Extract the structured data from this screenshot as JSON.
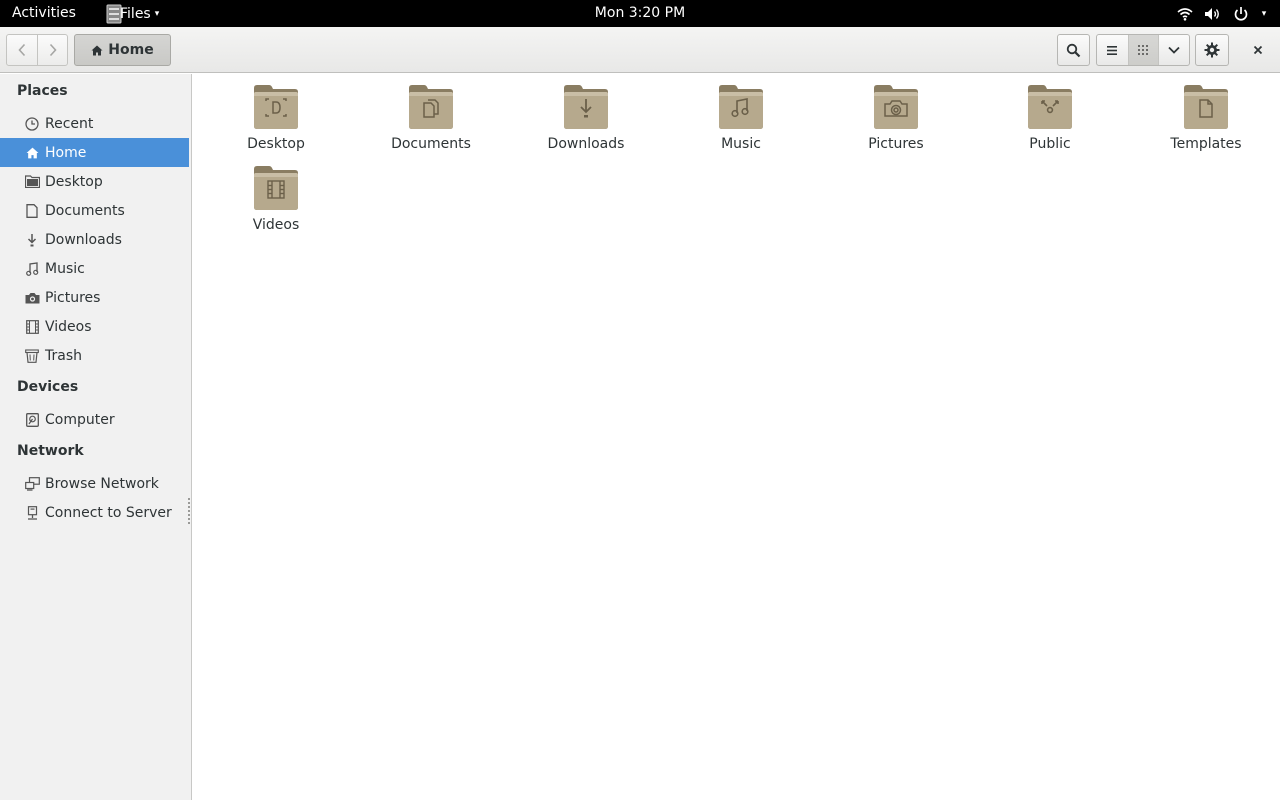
{
  "topbar": {
    "activities": "Activities",
    "app_name": "Files",
    "app_caret": "▾",
    "clock": "Mon  3:20 PM",
    "status_icons": [
      "wifi-icon",
      "volume-icon",
      "power-icon"
    ]
  },
  "headerbar": {
    "path_label": "Home",
    "icons": [
      "back-icon",
      "forward-icon",
      "home-icon",
      "search-icon",
      "list-view-icon",
      "grid-view-icon",
      "chevron-down-icon",
      "gear-icon",
      "close-icon"
    ],
    "active_view": "grid"
  },
  "sidebar": {
    "places_title": "Places",
    "places": [
      {
        "label": "Recent",
        "icon": "clock-icon"
      },
      {
        "label": "Home",
        "icon": "home-icon",
        "selected": true
      },
      {
        "label": "Desktop",
        "icon": "folder-icon"
      },
      {
        "label": "Documents",
        "icon": "document-icon"
      },
      {
        "label": "Downloads",
        "icon": "download-icon"
      },
      {
        "label": "Music",
        "icon": "music-icon"
      },
      {
        "label": "Pictures",
        "icon": "camera-icon"
      },
      {
        "label": "Videos",
        "icon": "film-icon"
      },
      {
        "label": "Trash",
        "icon": "trash-icon"
      }
    ],
    "devices_title": "Devices",
    "devices": [
      {
        "label": "Computer",
        "icon": "drive-icon"
      }
    ],
    "network_title": "Network",
    "network": [
      {
        "label": "Browse Network",
        "icon": "network-icon"
      },
      {
        "label": "Connect to Server",
        "icon": "server-icon"
      }
    ]
  },
  "content": {
    "folders": [
      {
        "name": "Desktop",
        "icon": "folder-desktop-icon"
      },
      {
        "name": "Documents",
        "icon": "folder-documents-icon"
      },
      {
        "name": "Downloads",
        "icon": "folder-downloads-icon"
      },
      {
        "name": "Music",
        "icon": "folder-music-icon"
      },
      {
        "name": "Pictures",
        "icon": "folder-pictures-icon"
      },
      {
        "name": "Public",
        "icon": "folder-public-icon"
      },
      {
        "name": "Templates",
        "icon": "folder-templates-icon"
      },
      {
        "name": "Videos",
        "icon": "folder-videos-icon"
      }
    ]
  },
  "colors": {
    "selection": "#4a90d9",
    "folder_body": "#b6a98d",
    "folder_dark": "#8a7d62",
    "topbar_bg": "#000000"
  }
}
